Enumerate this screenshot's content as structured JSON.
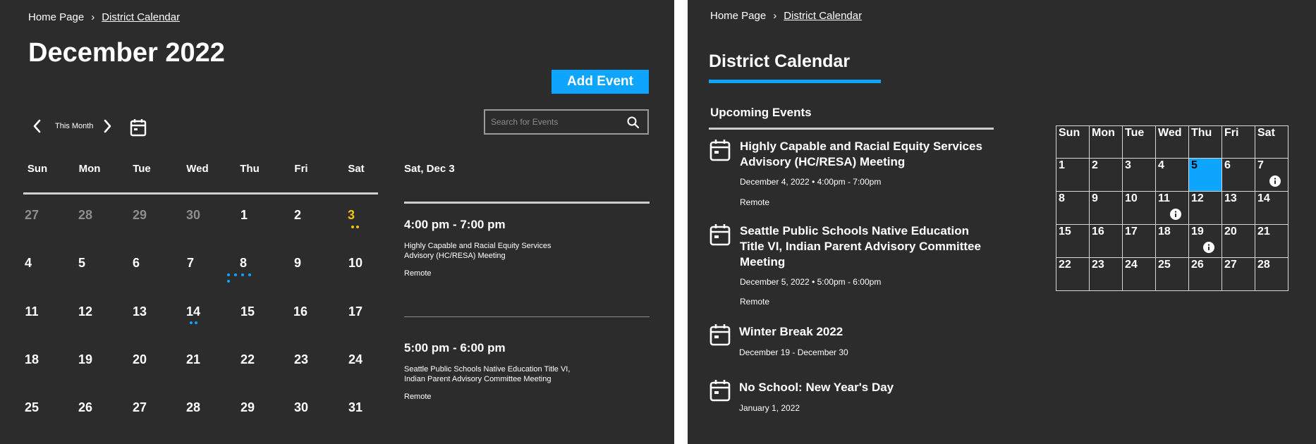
{
  "left": {
    "breadcrumb": {
      "home": "Home Page",
      "current": "District Calendar"
    },
    "month_title": "December 2022",
    "add_event_label": "Add Event",
    "search": {
      "placeholder": "Search for Events",
      "value": ""
    },
    "nav": {
      "this_month": "This Month"
    },
    "weekdays": [
      "Sun",
      "Mon",
      "Tue",
      "Wed",
      "Thu",
      "Fri",
      "Sat"
    ],
    "weeks": [
      [
        "27",
        "28",
        "29",
        "30",
        "1",
        "2",
        "3"
      ],
      [
        "4",
        "5",
        "6",
        "7",
        "8",
        "9",
        "10"
      ],
      [
        "11",
        "12",
        "13",
        "14",
        "15",
        "16",
        "17"
      ],
      [
        "18",
        "19",
        "20",
        "21",
        "22",
        "23",
        "24"
      ],
      [
        "25",
        "26",
        "27",
        "28",
        "29",
        "30",
        "31"
      ]
    ],
    "selected_date": "Sat, Dec 3",
    "events": [
      {
        "time": "4:00 pm - 7:00 pm",
        "title": "Highly Capable and Racial Equity Services Advisory (HC/RESA) Meeting",
        "location": "Remote"
      },
      {
        "time": "5:00 pm - 6:00 pm",
        "title": "Seattle Public Schools Native Education Title VI, Indian Parent Advisory Committee Meeting",
        "location": "Remote"
      }
    ]
  },
  "right": {
    "breadcrumb": {
      "home": "Home Page",
      "current": "District Calendar"
    },
    "page_title": "District Calendar",
    "upcoming_title": "Upcoming Events",
    "events": [
      {
        "title": "Highly Capable and Racial Equity Services Advisory (HC/RESA) Meeting",
        "date": "December 4, 2022",
        "time": "4:00pm - 7:00pm",
        "location": "Remote"
      },
      {
        "title": "Seattle Public Schools Native Education Title VI, Indian Parent Advisory Committee Meeting",
        "date": "December 5, 2022",
        "time": "5:00pm - 6:00pm",
        "location": "Remote"
      },
      {
        "title": "Winter Break 2022",
        "date": "December 19 - December 30"
      },
      {
        "title": "No School: New Year's Day",
        "date": "January 1, 2022"
      }
    ],
    "mini_calendar": {
      "weekdays": [
        "Sun",
        "Mon",
        "Tue",
        "Wed",
        "Thu",
        "Fri",
        "Sat"
      ],
      "weeks": [
        [
          "1",
          "2",
          "3",
          "4",
          "5",
          "6",
          "7"
        ],
        [
          "8",
          "9",
          "10",
          "11",
          "12",
          "13",
          "14"
        ],
        [
          "15",
          "16",
          "17",
          "18",
          "19",
          "20",
          "21"
        ],
        [
          "22",
          "23",
          "24",
          "25",
          "26",
          "27",
          "28"
        ]
      ]
    }
  },
  "colors": {
    "accent": "#0ea5ff",
    "highlight": "#f4c20d",
    "background": "#2c2c2c"
  },
  "icons": [
    "chevron-left-icon",
    "chevron-right-icon",
    "calendar-icon",
    "search-icon",
    "info-icon"
  ]
}
